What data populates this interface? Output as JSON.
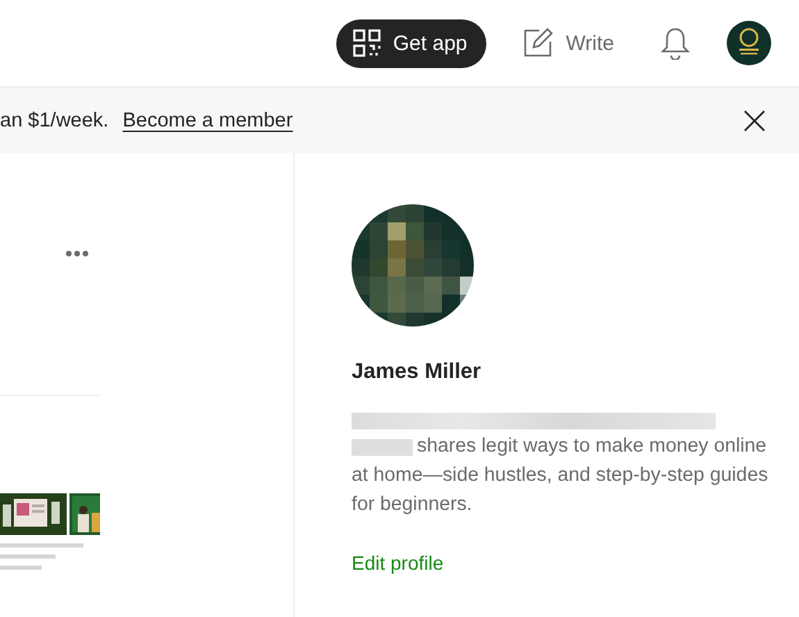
{
  "header": {
    "get_app": "Get app",
    "write": "Write"
  },
  "banner": {
    "text": "an $1/week.",
    "link": "Become a member"
  },
  "profile": {
    "name": "James Miller",
    "bio": "shares legit ways to make money online at home—side hustles, and step-by-step guides for beginners.",
    "edit": "Edit profile"
  }
}
